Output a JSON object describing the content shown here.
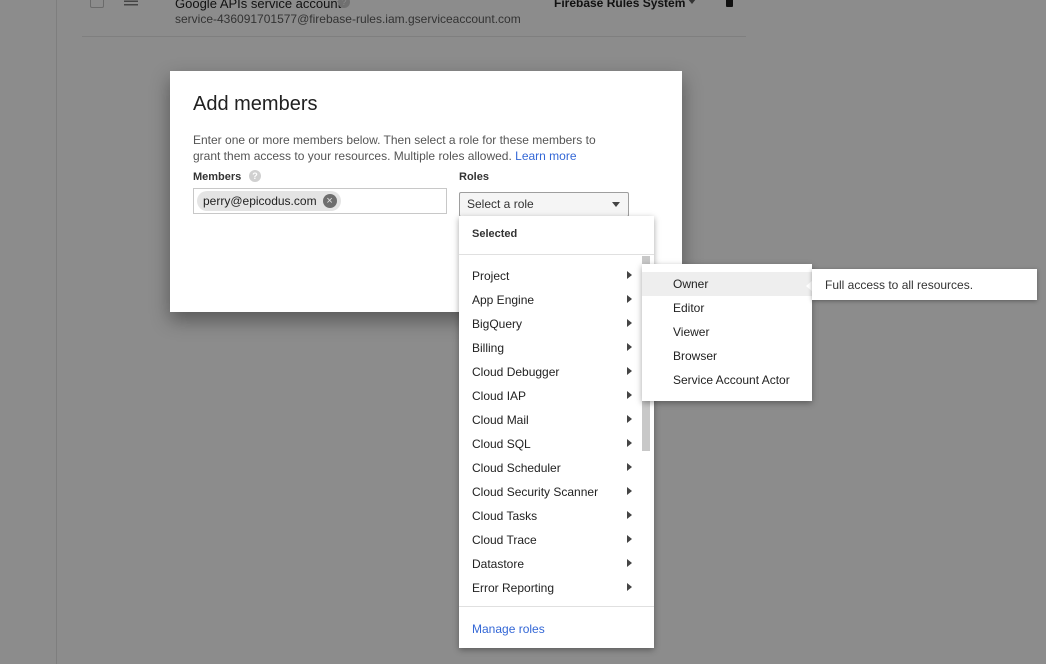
{
  "background_row": {
    "title": "Google APIs service account",
    "email": "service-436091701577@firebase-rules.iam.gserviceaccount.com",
    "role": "Firebase Rules System",
    "help_glyph": "?"
  },
  "dialog": {
    "title": "Add members",
    "description": "Enter one or more members below. Then select a role for these members to grant them access to your resources. Multiple roles allowed.",
    "learn_more": "Learn more",
    "members_label": "Members",
    "members_help_glyph": "?",
    "roles_label": "Roles",
    "member_chip": "perry@epicodus.com",
    "chip_remove_glyph": "×",
    "role_select_placeholder": "Select a role"
  },
  "role_menu": {
    "selected_header": "Selected",
    "categories": [
      "Project",
      "App Engine",
      "BigQuery",
      "Billing",
      "Cloud Debugger",
      "Cloud IAP",
      "Cloud Mail",
      "Cloud SQL",
      "Cloud Scheduler",
      "Cloud Security Scanner",
      "Cloud Tasks",
      "Cloud Trace",
      "Datastore",
      "Error Reporting"
    ],
    "manage_roles": "Manage roles"
  },
  "project_submenu": {
    "items": [
      "Owner",
      "Editor",
      "Viewer",
      "Browser",
      "Service Account Actor"
    ],
    "highlighted": "Owner"
  },
  "tooltip": {
    "text": "Full access to all resources."
  },
  "colors": {
    "link": "#3367d6",
    "overlay": "#8c8c8c"
  }
}
